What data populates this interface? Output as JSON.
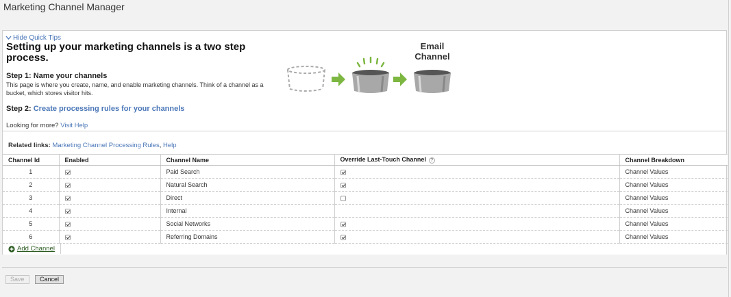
{
  "page": {
    "title": "Marketing Channel Manager"
  },
  "tips": {
    "toggle_label": "Hide Quick Tips",
    "heading": "Setting up your marketing channels is a two step process.",
    "step1_title": "Step 1: Name your channels",
    "step1_text": "This page is where you create, name, and enable marketing channels. Think of a channel as a bucket, which stores visitor hits.",
    "step2_prefix": "Step 2: ",
    "step2_link": "Create processing rules for your channels",
    "more_prefix": "Looking for more? ",
    "more_link": "Visit Help",
    "illustration_label_line1": "Email",
    "illustration_label_line2": "Channel"
  },
  "related": {
    "label": "Related links:",
    "link1": "Marketing Channel Processing Rules",
    "separator": ", ",
    "link2": "Help"
  },
  "table": {
    "headers": [
      "Channel Id",
      "Enabled",
      "Channel Name",
      "Override Last-Touch Channel",
      "Channel Breakdown"
    ],
    "help_glyph": "?",
    "rows": [
      {
        "id": "1",
        "enabled": true,
        "name": "Paid Search",
        "override": true,
        "breakdown": "Channel Values"
      },
      {
        "id": "2",
        "enabled": true,
        "name": "Natural Search",
        "override": true,
        "breakdown": "Channel Values"
      },
      {
        "id": "3",
        "enabled": true,
        "name": "Direct",
        "override": false,
        "breakdown": "Channel Values"
      },
      {
        "id": "4",
        "enabled": true,
        "name": "Internal",
        "override": null,
        "breakdown": "Channel Values"
      },
      {
        "id": "5",
        "enabled": true,
        "name": "Social Networks",
        "override": true,
        "breakdown": "Channel Values"
      },
      {
        "id": "6",
        "enabled": true,
        "name": "Referring Domains",
        "override": true,
        "breakdown": "Channel Values"
      }
    ]
  },
  "add_channel_label": "Add Channel",
  "buttons": {
    "save": "Save",
    "cancel": "Cancel"
  },
  "colors": {
    "link": "#4b77b8",
    "arrow": "#7db742",
    "add_icon": "#2a5a1f"
  }
}
